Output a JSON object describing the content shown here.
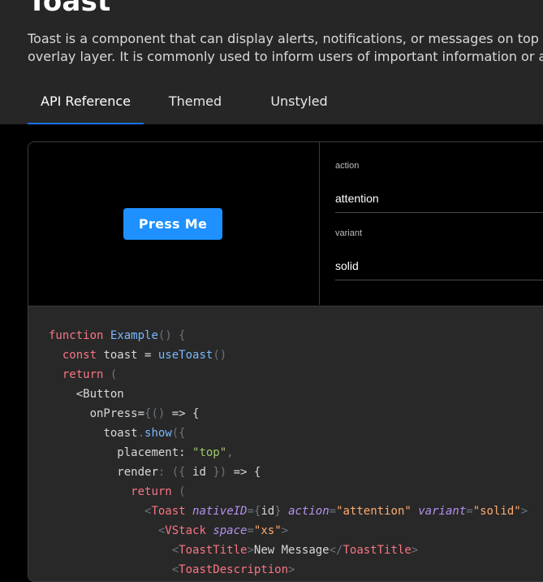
{
  "page": {
    "title": "Toast",
    "description_line1": "Toast is a component that can display alerts, notifications, or messages on top",
    "description_line2": "overlay layer. It is commonly used to inform users of important information or a"
  },
  "tabs": [
    {
      "label": "API Reference",
      "active": true
    },
    {
      "label": "Themed",
      "active": false
    },
    {
      "label": "Unstyled",
      "active": false
    }
  ],
  "preview": {
    "button_label": "Press Me"
  },
  "controls": [
    {
      "label": "action",
      "value": "attention"
    },
    {
      "label": "variant",
      "value": "solid"
    }
  ],
  "code": {
    "l1": {
      "kw": "function",
      "fn": "Example",
      "pu": "() {"
    },
    "l2": {
      "kw": "const",
      "pl": " toast = ",
      "fn": "useToast",
      "pu": "()"
    },
    "l3": {
      "kw": "return",
      "pu": " ("
    },
    "l4": {
      "pl": "<Button"
    },
    "l5": {
      "pl": "onPress=",
      "pu": "{()",
      "pl2": " => {"
    },
    "l6": {
      "pl": "toast",
      "pu": ".",
      "fn": "show",
      "pu2": "({"
    },
    "l7": {
      "pl": "placement: ",
      "st": "\"top\"",
      "pu": ","
    },
    "l8": {
      "pl": "render",
      "pu": ": ({",
      "pl2": " id ",
      "pu2": "})",
      "pl3": " => {"
    },
    "l9": {
      "kw": "return",
      "pu": " ("
    },
    "l10": {
      "pu": "<",
      "tg": "Toast",
      "at1": "nativeID",
      "pu2": "={",
      "pl": "id",
      "pu3": "}",
      "at2": "action",
      "av1": "\"attention\"",
      "at3": "variant",
      "av2": "\"solid\"",
      "pu4": ">"
    },
    "l11": {
      "pu": "<",
      "tg": "VStack",
      "at": "space",
      "av": "\"xs\"",
      "pu2": ">"
    },
    "l12": {
      "pu": "<",
      "tg": "ToastTitle",
      "pu2": ">",
      "pl": "New Message",
      "pu3": "</",
      "tg2": "ToastTitle",
      "pu4": ">"
    },
    "l13": {
      "pu": "<",
      "tg": "ToastDescription",
      "pu2": ">"
    }
  },
  "colors": {
    "accent": "#1e90ff",
    "tab_indicator": "#1a73e8",
    "header_bg": "#262626",
    "code_bg": "#282828"
  }
}
